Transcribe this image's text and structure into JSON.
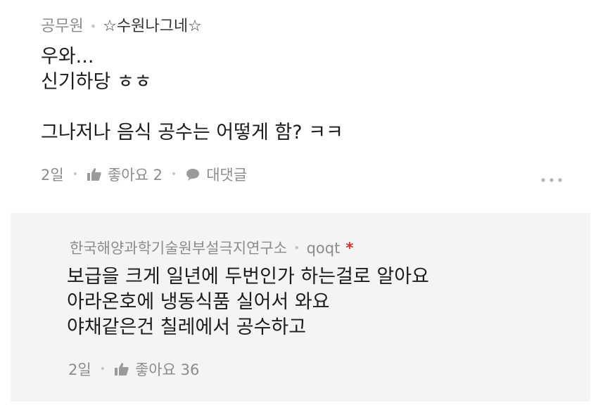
{
  "comment": {
    "author_org": "공무원",
    "nickname": "☆수원나그네☆",
    "body": "우와...\n신기하당 ㅎㅎ\n\n그나저나 음식 공수는 어떻게 함? ㅋㅋ",
    "time": "2일",
    "like_label": "좋아요 2",
    "reply_label": "대댓글",
    "more_icon": "more-dots-icon"
  },
  "reply": {
    "author_org": "한국해양과학기술원부설극지연구소",
    "nickname": "qoqt",
    "badge": "*",
    "body": "보급을 크게 일년에 두번인가 하는걸로 알아요\n아라온호에 냉동식품 실어서 와요\n야채같은건 칠레에서 공수하고",
    "time": "2일",
    "like_label": "좋아요 36"
  },
  "colors": {
    "meta_gray": "#8c8c8c",
    "text": "#1c1c1c",
    "reply_bg": "#f4f4f4",
    "badge_red": "#d32f2f"
  }
}
